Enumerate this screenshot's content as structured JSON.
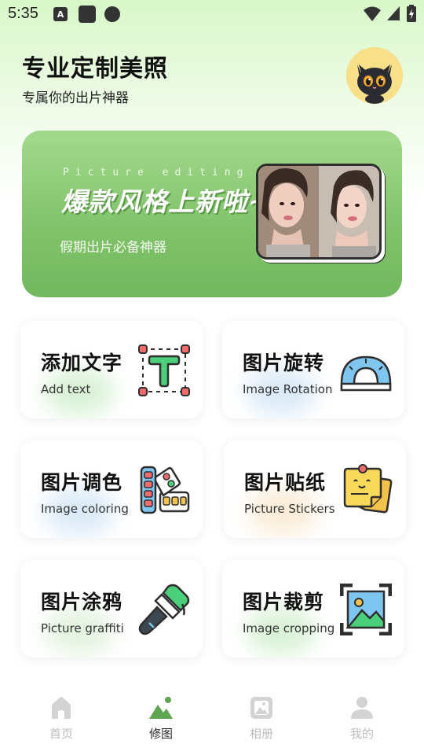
{
  "status_bar": {
    "time": "5:35",
    "a_badge": "A"
  },
  "header": {
    "title": "专业定制美照",
    "subtitle": "专属你的出片神器"
  },
  "banner": {
    "english_caption": "Picture editing",
    "title": "爆款风格上新啦~",
    "subtitle": "假期出片必备神器"
  },
  "features": [
    {
      "title": "添加文字",
      "subtitle": "Add text",
      "icon": "text-tool-icon",
      "glow": "#b9e7b4"
    },
    {
      "title": "图片旋转",
      "subtitle": "Image Rotation",
      "icon": "protractor-icon",
      "glow": "#bcd8f2"
    },
    {
      "title": "图片调色",
      "subtitle": "Image coloring",
      "icon": "color-palette-icon",
      "glow": "#bcd8f2"
    },
    {
      "title": "图片贴纸",
      "subtitle": "Picture Stickers",
      "icon": "sticker-note-icon",
      "glow": "#f6dcb6"
    },
    {
      "title": "图片涂鸦",
      "subtitle": "Picture graffiti",
      "icon": "paint-brush-icon",
      "glow": "#cde8c6"
    },
    {
      "title": "图片裁剪",
      "subtitle": "Image cropping",
      "icon": "crop-frame-icon",
      "glow": "#b9e7b4"
    }
  ],
  "nav": {
    "items": [
      {
        "label": "首页",
        "icon": "home-icon",
        "active": false
      },
      {
        "label": "修图",
        "icon": "edit-photo-icon",
        "active": true
      },
      {
        "label": "相册",
        "icon": "album-icon",
        "active": false
      },
      {
        "label": "我的",
        "icon": "profile-icon",
        "active": false
      }
    ]
  },
  "colors": {
    "accent_green": "#6fb85a",
    "nav_inactive": "#bdbdbd",
    "banner_green": "#80c26a"
  }
}
